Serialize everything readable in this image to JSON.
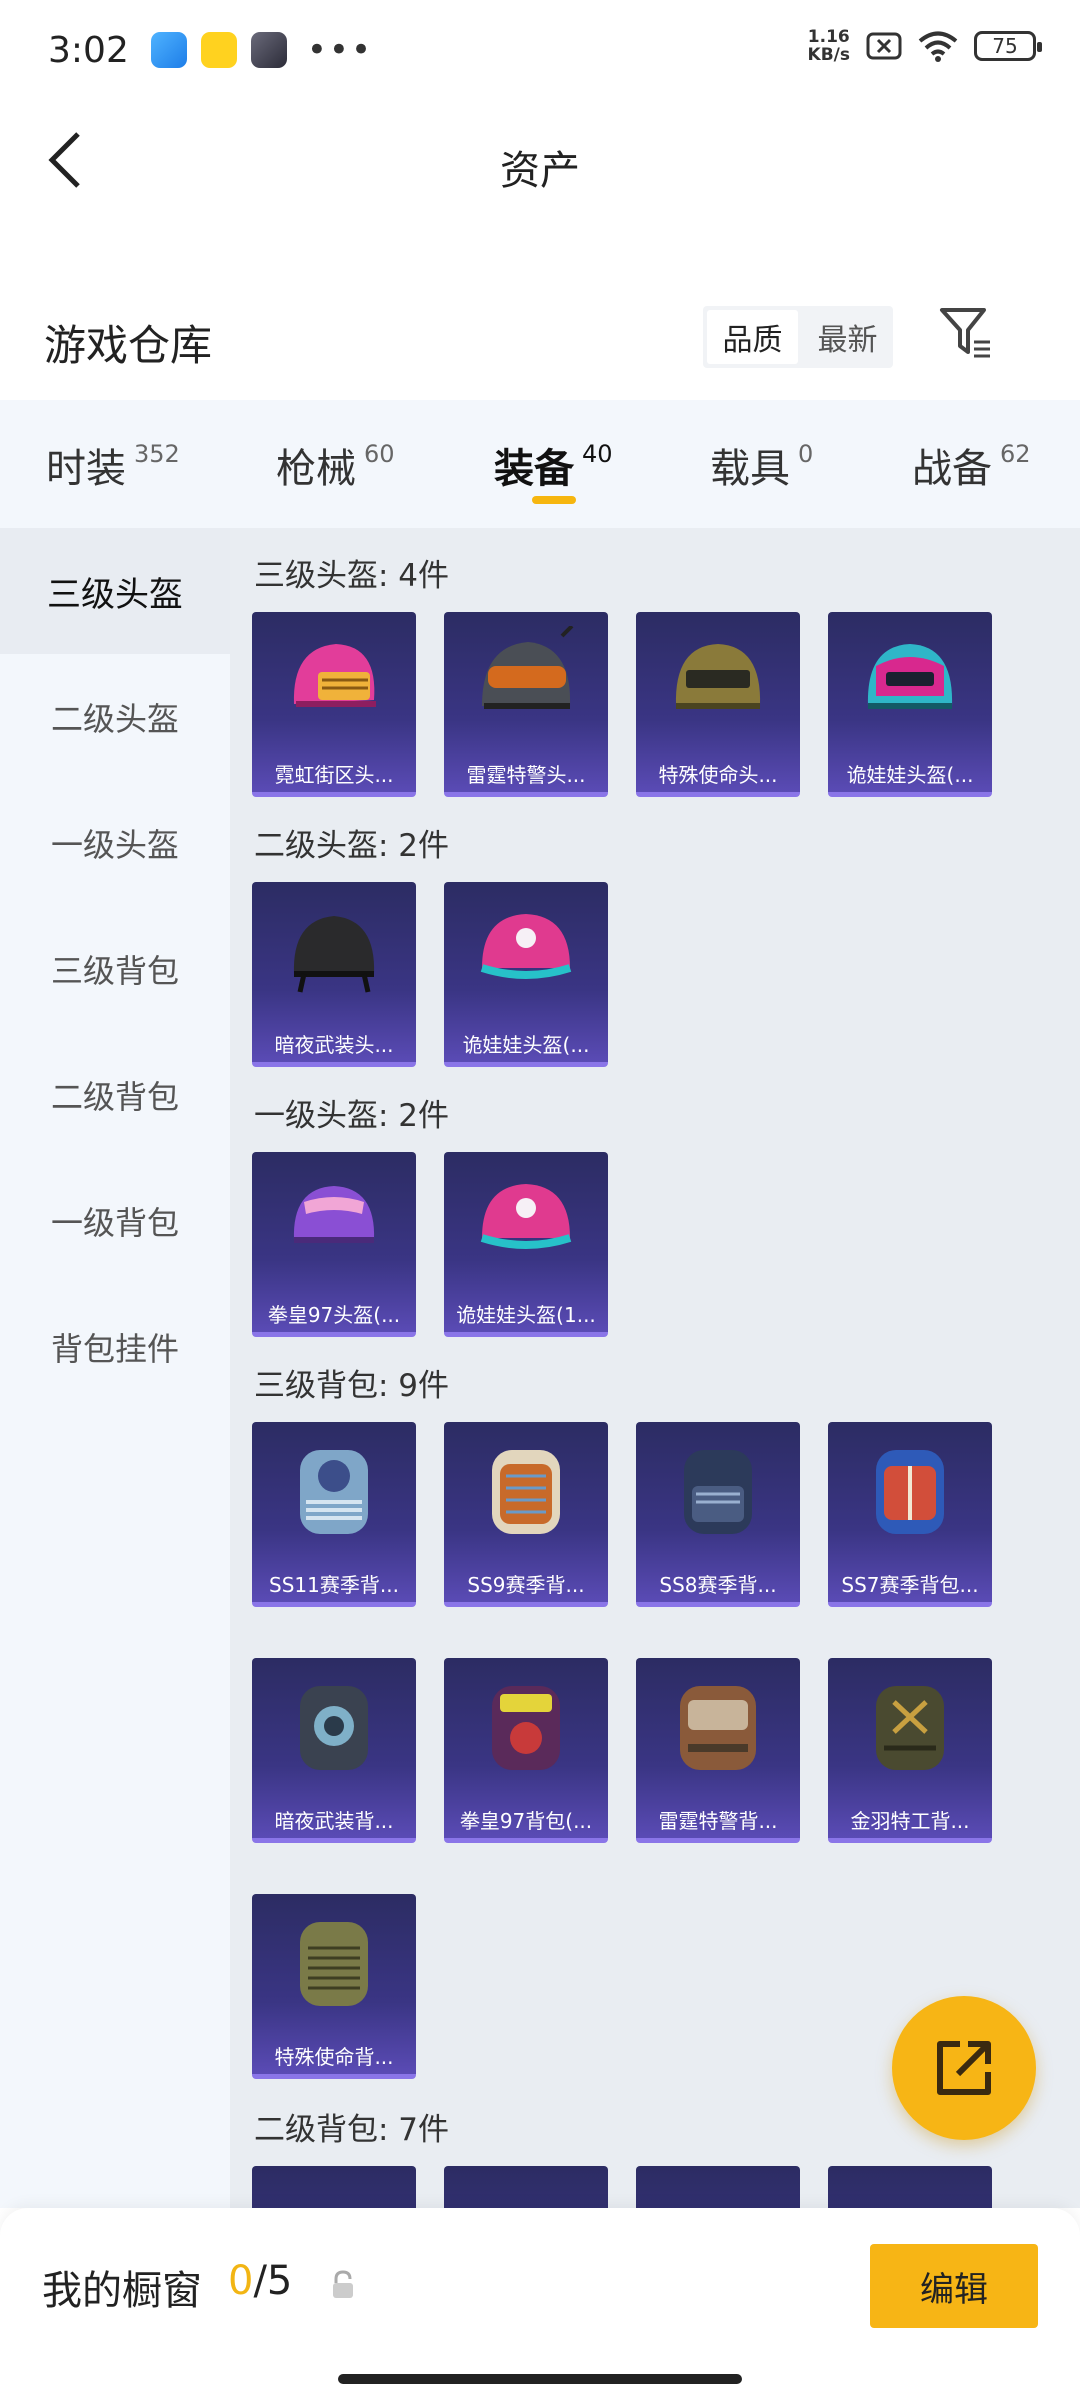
{
  "status": {
    "time": "3:02",
    "speed_value": "1.16",
    "speed_unit": "KB/s",
    "battery": "75",
    "icons": [
      "app-icon-blue",
      "app-icon-yellow",
      "app-icon-avatar",
      "more-dots-icon",
      "sim-off-icon",
      "wifi-icon",
      "battery-icon"
    ]
  },
  "nav": {
    "title": "资产"
  },
  "warehouse": {
    "title": "游戏仓库",
    "sort_quality": "品质",
    "sort_newest": "最新"
  },
  "tabs": [
    {
      "label": "时装",
      "count": "352"
    },
    {
      "label": "枪械",
      "count": "60"
    },
    {
      "label": "装备",
      "count": "40"
    },
    {
      "label": "载具",
      "count": "0"
    },
    {
      "label": "战备",
      "count": "62"
    }
  ],
  "sidebar": [
    "三级头盔",
    "二级头盔",
    "一级头盔",
    "三级背包",
    "二级背包",
    "一级背包",
    "背包挂件"
  ],
  "sections": [
    {
      "title": "三级头盔: 4件",
      "items": [
        "霓虹街区头...",
        "雷霆特警头...",
        "特殊使命头...",
        "诡娃娃头盔(..."
      ]
    },
    {
      "title": "二级头盔: 2件",
      "items": [
        "暗夜武装头...",
        "诡娃娃头盔(..."
      ]
    },
    {
      "title": "一级头盔: 2件",
      "items": [
        "拳皇97头盔(...",
        "诡娃娃头盔(1..."
      ]
    },
    {
      "title": "三级背包: 9件",
      "items": [
        "SS11赛季背...",
        "SS9赛季背...",
        "SS8赛季背...",
        "SS7赛季背包...",
        "暗夜武装背...",
        "拳皇97背包(...",
        "雷霆特警背...",
        "金羽特工背...",
        "特殊使命背..."
      ]
    },
    {
      "title": "二级背包: 7件",
      "items": [
        "",
        "",
        "",
        ""
      ]
    }
  ],
  "bottom": {
    "showcase_label": "我的橱窗",
    "showcase_current": "0",
    "showcase_total": "/5",
    "edit_label": "编辑"
  },
  "colors": {
    "accent": "#f7b515",
    "item_bg": "#3a3584",
    "item_border": "#8a75e8",
    "tab_bg": "#f3f7fc"
  }
}
